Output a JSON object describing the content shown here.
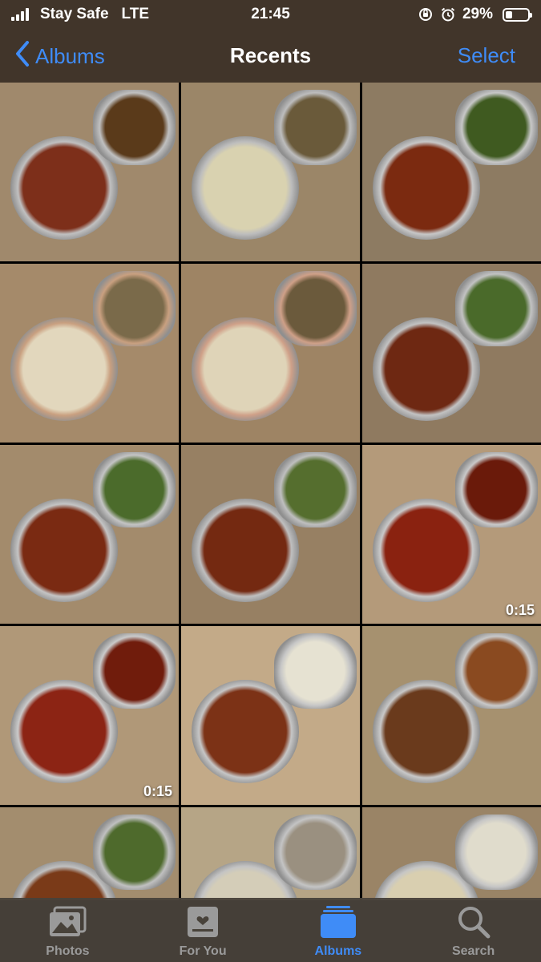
{
  "status_bar": {
    "carrier": "Stay Safe",
    "network": "LTE",
    "time": "21:45",
    "battery_percent": "29%",
    "battery_level": 0.29
  },
  "nav_bar": {
    "back_label": "Albums",
    "title": "Recents",
    "select_label": "Select"
  },
  "photos": [
    {
      "type": "photo"
    },
    {
      "type": "photo"
    },
    {
      "type": "photo"
    },
    {
      "type": "photo"
    },
    {
      "type": "photo"
    },
    {
      "type": "photo"
    },
    {
      "type": "photo"
    },
    {
      "type": "photo"
    },
    {
      "type": "video",
      "duration": "0:15"
    },
    {
      "type": "video",
      "duration": "0:15"
    },
    {
      "type": "photo"
    },
    {
      "type": "photo"
    },
    {
      "type": "photo"
    },
    {
      "type": "photo"
    },
    {
      "type": "photo"
    }
  ],
  "tab_bar": {
    "tabs": [
      {
        "label": "Photos",
        "icon": "photos-icon"
      },
      {
        "label": "For You",
        "icon": "for-you-icon"
      },
      {
        "label": "Albums",
        "icon": "albums-icon"
      },
      {
        "label": "Search",
        "icon": "search-icon"
      }
    ],
    "active_index": 2
  },
  "colors": {
    "accent": "#3f8cf7",
    "bar_background": "#463a2e",
    "tab_inactive": "#9a9a9a"
  }
}
